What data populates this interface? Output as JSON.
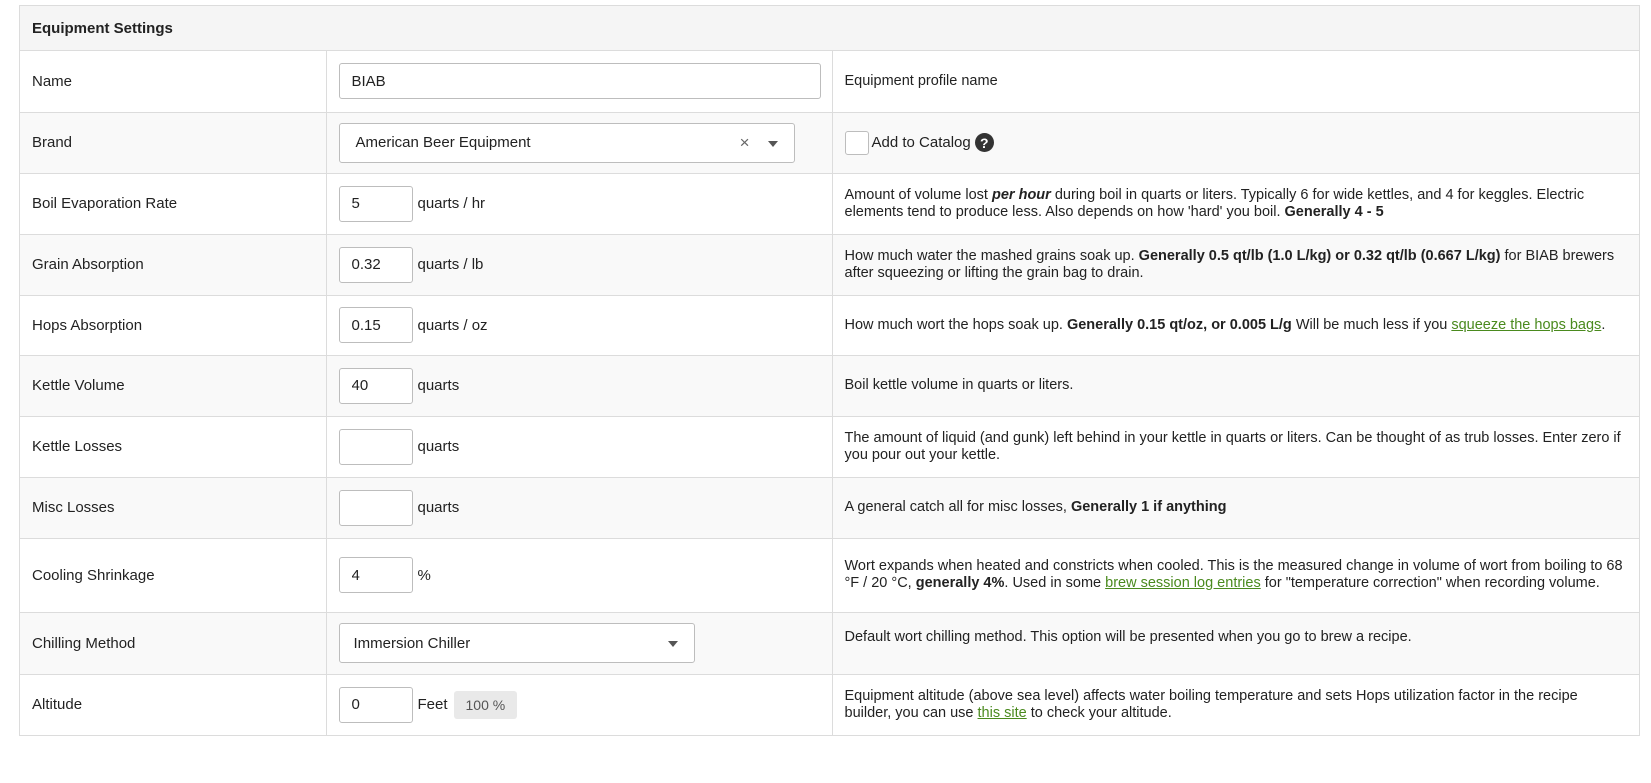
{
  "panel": {
    "title": "Equipment Settings"
  },
  "rows": {
    "name": {
      "label": "Name",
      "value": "BIAB",
      "desc": "Equipment profile name"
    },
    "brand": {
      "label": "Brand",
      "value": "American Beer Equipment",
      "clear": "×",
      "catalog_label": "Add to Catalog",
      "help": "?"
    },
    "boil": {
      "label": "Boil Evaporation Rate",
      "value": "5",
      "unit": "quarts / hr",
      "desc1": "Amount of volume lost ",
      "desc_em": "per hour",
      "desc2": " during boil in quarts or liters. Typically 6 for wide kettles, and 4 for keggles. Electric elements tend to produce less. Also depends on how 'hard' you boil. ",
      "desc_bold": "Generally 4 - 5"
    },
    "grain": {
      "label": "Grain Absorption",
      "value": "0.32",
      "unit": "quarts / lb",
      "desc1": "How much water the mashed grains soak up. ",
      "desc_bold": "Generally 0.5 qt/lb (1.0 L/kg) or 0.32 qt/lb (0.667 L/kg)",
      "desc2": " for BIAB brewers after squeezing or lifting the grain bag to drain."
    },
    "hops": {
      "label": "Hops Absorption",
      "value": "0.15",
      "unit": "quarts / oz",
      "desc1": "How much wort the hops soak up. ",
      "desc_bold": "Generally 0.15 qt/oz, or 0.005 L/g",
      "desc2": " Will be much less if you ",
      "link": "squeeze the hops bags",
      "desc3": "."
    },
    "kettle_volume": {
      "label": "Kettle Volume",
      "value": "40",
      "unit": "quarts",
      "desc": "Boil kettle volume in quarts or liters."
    },
    "kettle_losses": {
      "label": "Kettle Losses",
      "value": "",
      "unit": "quarts",
      "desc": "The amount of liquid (and gunk) left behind in your kettle in quarts or liters. Can be thought of as trub losses. Enter zero if you pour out your kettle."
    },
    "misc": {
      "label": "Misc Losses",
      "value": "",
      "unit": "quarts",
      "desc1": "A general catch all for misc losses, ",
      "desc_bold": "Generally 1 if anything"
    },
    "cooling": {
      "label": "Cooling Shrinkage",
      "value": "4",
      "unit": "%",
      "desc1": "Wort expands when heated and constricts when cooled. This is the measured change in volume of wort from boiling to 68 °F / 20 °C, ",
      "desc_bold": "generally 4%",
      "desc2": ". Used in some ",
      "link": "brew session log entries",
      "desc3": " for \"temperature correction\" when recording volume."
    },
    "chilling": {
      "label": "Chilling Method",
      "value": "Immersion Chiller",
      "desc": "Default wort chilling method. This option will be presented when you go to brew a recipe."
    },
    "altitude": {
      "label": "Altitude",
      "value": "0",
      "unit": "Feet",
      "badge": "100 %",
      "desc1": "Equipment altitude (above sea level) affects water boiling temperature and sets Hops utilization factor in the recipe builder, you can use ",
      "link": "this site",
      "desc2": " to check your altitude."
    }
  }
}
